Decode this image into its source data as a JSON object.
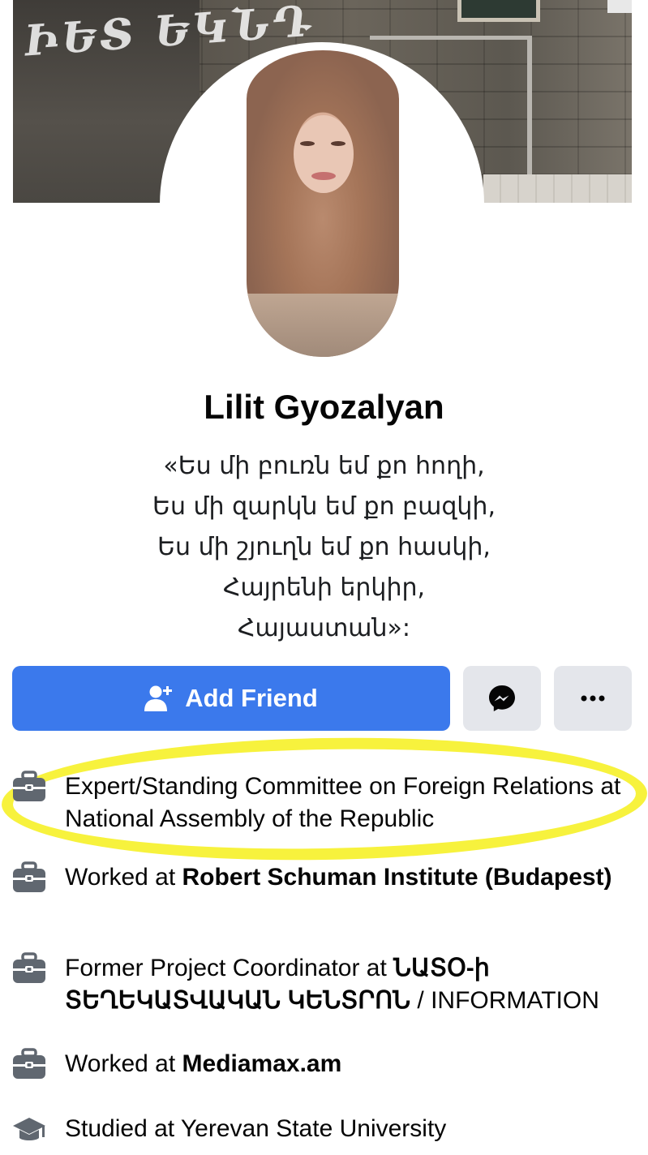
{
  "profile": {
    "name": "Lilit Gyozalyan",
    "bio_lines": [
      "«Ես մի բուռն եմ քո հողի,",
      "Ես մի զարկն եմ քո բազկի,",
      "Ես մի շյուղն եմ քո հասկի,",
      "Հայրենի երկիր,",
      "Հայաստան»:"
    ]
  },
  "cover": {
    "graffiti_text": "ԻԵՏ ԵԿՆԴ"
  },
  "actions": {
    "add_friend_label": "Add Friend",
    "add_friend_icon": "person-add-icon",
    "messenger_icon": "messenger-icon",
    "more_icon": "more-icon"
  },
  "info": [
    {
      "icon": "briefcase-icon",
      "prefix": "Expert/Standing Committee on Foreign Relations at National Assembly of the Republic",
      "bold": "",
      "highlighted": true
    },
    {
      "icon": "briefcase-icon",
      "prefix": "Worked at ",
      "bold": "Robert Schuman Institute (Budapest)"
    },
    {
      "icon": "briefcase-icon",
      "prefix": "Former Project Coordinator at ",
      "bold": "ՆԱՏՕ-ի ՏԵՂԵԿԱՏՎԱԿԱՆ ԿԵՆՏՐՈՆ",
      "suffix": " / INFORMATION"
    },
    {
      "icon": "briefcase-icon",
      "prefix": "Worked at ",
      "bold": "Mediamax.am"
    },
    {
      "icon": "graduation-cap-icon",
      "prefix": "Studied at Yerevan State University",
      "bold": ""
    }
  ],
  "colors": {
    "primary_button": "#3b79ec",
    "secondary_button": "#e4e6eb",
    "highlight": "#f7f23d",
    "icon": "#606770"
  }
}
